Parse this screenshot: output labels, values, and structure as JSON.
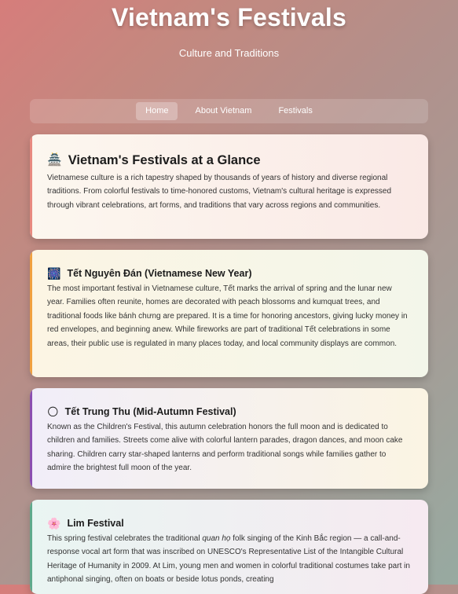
{
  "header": {
    "title": "Vietnam's Festivals",
    "subtitle": "Culture and Traditions"
  },
  "nav": {
    "items": [
      {
        "label": "Home",
        "active": true
      },
      {
        "label": "About Vietnam",
        "active": false
      },
      {
        "label": "Festivals",
        "active": false
      }
    ]
  },
  "cards": {
    "intro": {
      "icon": "pagoda-icon",
      "title": "Vietnam's Festivals at a Glance",
      "text": "Vietnamese culture is a rich tapestry shaped by thousands of years of history and diverse regional traditions. From colorful festivals to time-honored customs, Vietnam's cultural heritage is expressed through vibrant celebrations, art forms, and traditions that vary across regions and communities."
    },
    "tet": {
      "icon": "fireworks-icon",
      "title": "Tết Nguyên Đán (Vietnamese New Year)",
      "text": "The most important festival in Vietnamese culture, Tết marks the arrival of spring and the lunar new year. Families often reunite, homes are decorated with peach blossoms and kumquat trees, and traditional foods like bánh chưng are prepared. It is a time for honoring ancestors, giving lucky money in red envelopes, and beginning anew. While fireworks are part of traditional Tết celebrations in some areas, their public use is regulated in many places today, and local community displays are common."
    },
    "mid_autumn": {
      "icon": "moon-icon",
      "title": "Tết Trung Thu (Mid-Autumn Festival)",
      "text": "Known as the Children's Festival, this autumn celebration honors the full moon and is dedicated to children and families. Streets come alive with colorful lantern parades, dragon dances, and moon cake sharing. Children carry star-shaped lanterns and perform traditional songs while families gather to admire the brightest full moon of the year."
    },
    "lim": {
      "icon": "blossom-icon",
      "title": "Lim Festival",
      "text_before": "This spring festival celebrates the traditional ",
      "text_italic": "quan họ",
      "text_after": " folk singing of the Kinh Bắc region — a call-and-response vocal art form that was inscribed on UNESCO's Representative List of the Intangible Cultural Heritage of Humanity in 2009. At Lim, young men and women in colorful traditional costumes take part in antiphonal singing, often on boats or beside lotus ponds, creating"
    }
  }
}
